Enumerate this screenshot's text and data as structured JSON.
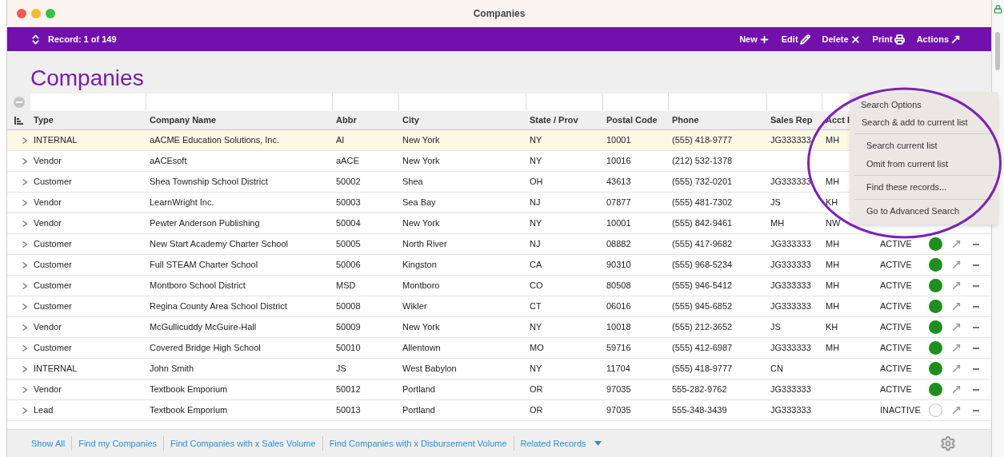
{
  "window": {
    "title": "Companies"
  },
  "toolbar": {
    "record": "Record: 1 of 149",
    "buttons": [
      {
        "label": "New",
        "kind": "new"
      },
      {
        "label": "Edit",
        "kind": "edit"
      },
      {
        "label": "Delete",
        "kind": "delete"
      },
      {
        "label": "Print",
        "kind": "print"
      },
      {
        "label": "Actions",
        "kind": "actions"
      }
    ]
  },
  "heading": "Companies",
  "table": {
    "columns": [
      "Type",
      "Company Name",
      "Abbr",
      "City",
      "State / Prov",
      "Postal Code",
      "Phone",
      "Sales Rep",
      "Acct I"
    ],
    "rows": [
      {
        "selected": true,
        "cells": [
          "INTERNAL",
          "aACME Education Solutions, Inc.",
          "AI",
          "New York",
          "NY",
          "10001",
          "(555) 418-9777",
          "JG333333",
          "MH"
        ]
      },
      {
        "selected": false,
        "cells": [
          "Vendor",
          "aACEsoft",
          "aACE",
          "New York",
          "NY",
          "10016",
          "(212) 532-1378",
          "",
          ""
        ]
      },
      {
        "selected": false,
        "cells": [
          "Customer",
          "Shea Township School District",
          "50002",
          "Shea",
          "OH",
          "43613",
          "(555) 732-0201",
          "JG333333",
          "MH"
        ]
      },
      {
        "selected": false,
        "cells": [
          "Vendor",
          "LearnWright Inc.",
          "50003",
          "Sea Bay",
          "NJ",
          "07877",
          "(555) 481-7302",
          "JS",
          "KH"
        ]
      },
      {
        "selected": false,
        "cells": [
          "Vendor",
          "Pewter Anderson Publishing",
          "50004",
          "New York",
          "NY",
          "10001",
          "(555) 842-9461",
          "MH",
          "NW"
        ]
      },
      {
        "selected": false,
        "cells": [
          "Customer",
          "New Start Academy Charter School",
          "50005",
          "North River",
          "NJ",
          "08882",
          "(555) 417-9682",
          "JG333333",
          "MH"
        ],
        "status": "ACTIVE",
        "active": true
      },
      {
        "selected": false,
        "cells": [
          "Customer",
          "Full STEAM Charter School",
          "50006",
          "Kingston",
          "CA",
          "90310",
          "(555) 968-5234",
          "JG333333",
          "MH"
        ],
        "status": "ACTIVE",
        "active": true
      },
      {
        "selected": false,
        "cells": [
          "Customer",
          "Montboro School District",
          "MSD",
          "Montboro",
          "CO",
          "80508",
          "(555) 946-5412",
          "JG333333",
          "MH"
        ],
        "status": "ACTIVE",
        "active": true
      },
      {
        "selected": false,
        "cells": [
          "Customer",
          "Regina County Area School District",
          "50008",
          "Wikler",
          "CT",
          "06016",
          "(555) 945-6852",
          "JG333333",
          "MH"
        ],
        "status": "ACTIVE",
        "active": true
      },
      {
        "selected": false,
        "cells": [
          "Vendor",
          "McGullicuddy McGuire-Hall",
          "50009",
          "New York",
          "NY",
          "10018",
          "(555) 212-3652",
          "JS",
          "KH"
        ],
        "status": "ACTIVE",
        "active": true
      },
      {
        "selected": false,
        "cells": [
          "Customer",
          "Covered Bridge High School",
          "50010",
          "Allentown",
          "MO",
          "59716",
          "(555) 412-6987",
          "JG333333",
          "MH"
        ],
        "status": "ACTIVE",
        "active": true
      },
      {
        "selected": false,
        "cells": [
          "INTERNAL",
          "John Smith",
          "JS",
          "West Babylon",
          "NY",
          "11704",
          "(555) 418-9777",
          "CN",
          ""
        ],
        "status": "ACTIVE",
        "active": true
      },
      {
        "selected": false,
        "cells": [
          "Vendor",
          "Textbook Emporium",
          "50012",
          "Portland",
          "OR",
          "97035",
          "555-282-9762",
          "JG333333",
          ""
        ],
        "status": "ACTIVE",
        "active": true
      },
      {
        "selected": false,
        "cells": [
          "Lead",
          "Textbook Emporium",
          "50013",
          "Portland",
          "OR",
          "97035",
          "555-348-3439",
          "JG333333",
          ""
        ],
        "status": "INACTIVE",
        "active": false
      }
    ]
  },
  "search_menu": {
    "title": "Search Options",
    "groups": [
      [
        "Search & add to current list"
      ],
      [
        "Search current list",
        "Omit from current list"
      ],
      [
        "Find these records..."
      ],
      [
        "Go to Advanced Search"
      ]
    ]
  },
  "footer": {
    "links": [
      "Show All",
      "Find my Companies",
      "Find Companies with x Sales Volume",
      "Find Companies with x Disbursement Volume"
    ],
    "related": "Related Records"
  }
}
